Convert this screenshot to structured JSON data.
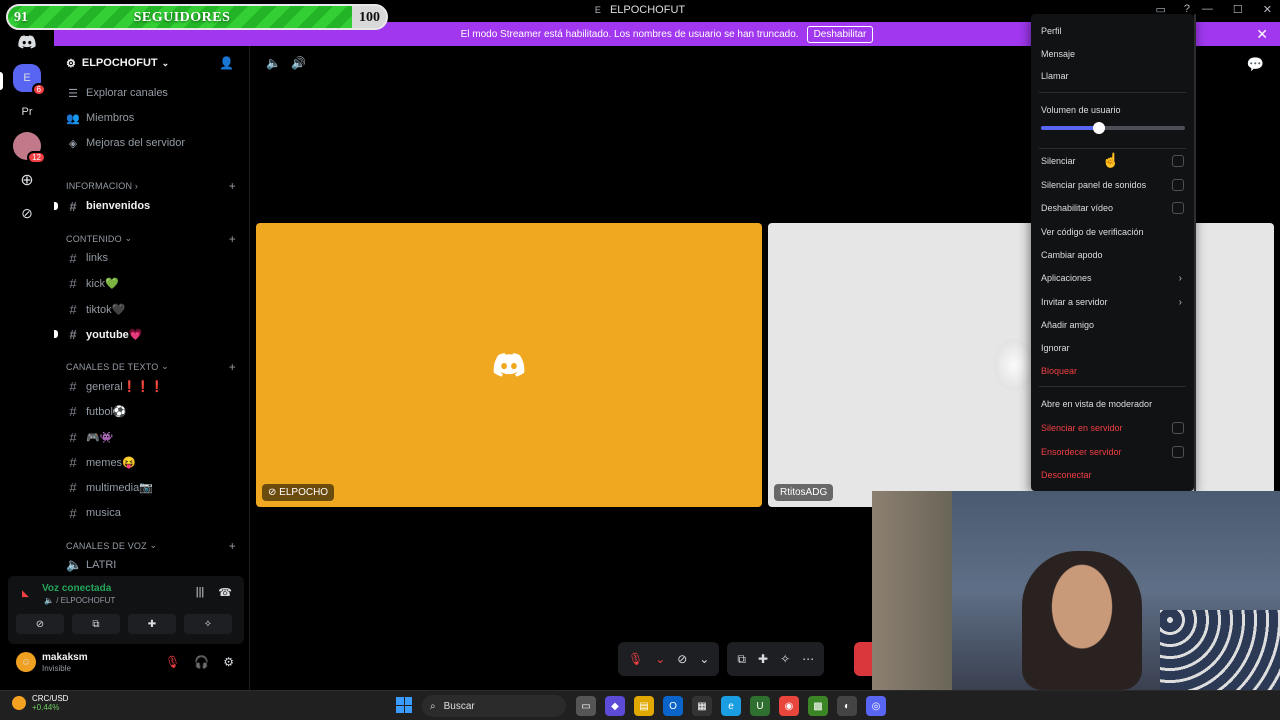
{
  "window": {
    "title": "ELPOCHOFUT",
    "title_icon": "E"
  },
  "follower_goal": {
    "label": "SEGUIDORES",
    "current": "91",
    "target": "100",
    "progress": 0.91
  },
  "banner": {
    "text": "El modo Streamer está habilitado. Los nombres de usuario se han truncado.",
    "button": "Deshabilitar"
  },
  "rail": {
    "server_e": "E",
    "server_pr": "Pr",
    "badge_e": "6",
    "badge_avatar": "12"
  },
  "server": {
    "name": "ELPOCHOFUT"
  },
  "nav": {
    "explore": "Explorar canales",
    "members": "Miembros",
    "boosts": "Mejoras del servidor"
  },
  "categories": {
    "informacion": "INFORMACION",
    "contenido": "CONTENIDO",
    "texto": "CANALES DE TEXTO",
    "voz": "CANALES DE VOZ"
  },
  "channels": {
    "bienvenidos": "bienvenidos",
    "links": "links",
    "kick": "kick💚",
    "tiktok": "tiktok🖤",
    "youtube": "youtube💗",
    "general": "general❗️❗️❗️",
    "futbol": "futbol⚽",
    "games": "🎮👾",
    "memes": "memes😝",
    "multimedia": "multimedia📷",
    "musica": "musica",
    "latri": "LATRI"
  },
  "voice": {
    "status": "Voz conectada",
    "channel": "/ ELPOCHOFUT"
  },
  "user": {
    "name": "makaksm",
    "status": "Invisible"
  },
  "tiles": {
    "tile1_name": "ELPOCHO",
    "tile2_name": "RtitosADG"
  },
  "menu": {
    "profile": "Perfil",
    "message": "Mensaje",
    "call": "Llamar",
    "user_volume": "Volumen de usuario",
    "volume_level": 0.4,
    "mute": "Silenciar",
    "mute_soundboard": "Silenciar panel de sonidos",
    "disable_video": "Deshabilitar vídeo",
    "verification": "Ver código de verificación",
    "nickname": "Cambiar apodo",
    "apps": "Aplicaciones",
    "invite": "Invitar a servidor",
    "add_friend": "Añadir amigo",
    "ignore": "Ignorar",
    "block": "Bloquear",
    "mod_view": "Abre en vista de moderador",
    "server_mute": "Silenciar en servidor",
    "server_deafen": "Ensordecer servidor",
    "disconnect": "Desconectar"
  },
  "taskbar": {
    "ticker": "CRC/USD",
    "change": "+0.44%",
    "search": "Buscar"
  },
  "colors": {
    "blurple": "#5865f2",
    "streamer": "#a138f0",
    "danger": "#f23f43",
    "online": "#23a55a",
    "tile1": "#f0a821"
  }
}
